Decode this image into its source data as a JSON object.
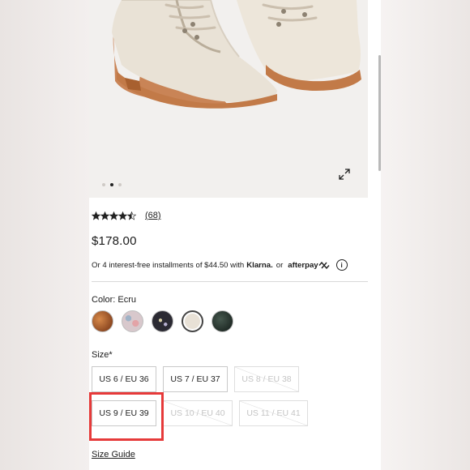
{
  "product_image": {
    "alt": "lace-up boots",
    "carousel_dots": 3,
    "active_dot": 1
  },
  "rating": {
    "stars": 4.5,
    "count_label": "(68)"
  },
  "price": "$178.00",
  "installments": {
    "text": "Or 4 interest-free installments of $44.50 with",
    "klarna": "Klarna.",
    "or": "or",
    "afterpay": "afterpay"
  },
  "color": {
    "label": "Color: Ecru",
    "selected_index": 3,
    "swatches": [
      {
        "name": "swatch-tan",
        "hex": "#b3652e"
      },
      {
        "name": "swatch-floral",
        "hex": "#d8c8cc"
      },
      {
        "name": "swatch-black-star",
        "hex": "#2b2a33"
      },
      {
        "name": "swatch-ecru",
        "hex": "#e8e1d6"
      },
      {
        "name": "swatch-dark-green",
        "hex": "#2c3a33"
      }
    ]
  },
  "size": {
    "label": "Size*",
    "options": [
      {
        "label": "US 6 / EU 36",
        "available": true
      },
      {
        "label": "US 7 / EU 37",
        "available": true
      },
      {
        "label": "US 8 / EU 38",
        "available": false
      },
      {
        "label": "US 9 / EU 39",
        "available": true,
        "highlighted": true
      },
      {
        "label": "US 10 / EU 40",
        "available": false
      },
      {
        "label": "US 11 / EU 41",
        "available": false
      }
    ]
  },
  "size_guide": "Size Guide",
  "colors": {
    "highlight": "#e63a3a",
    "text": "#1a1a1a"
  }
}
